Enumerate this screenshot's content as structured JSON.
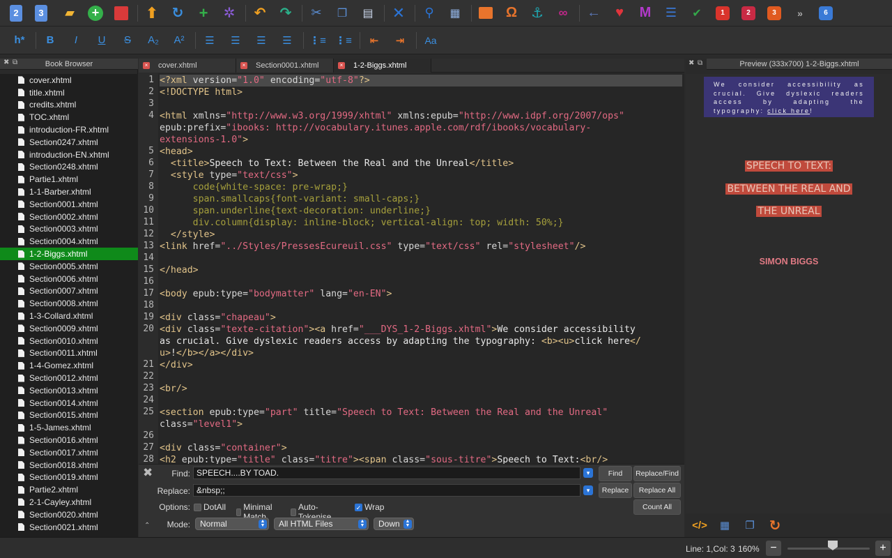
{
  "toolbar": {
    "icons": [
      "new-epub2-icon",
      "new-epub3-icon",
      "open-folder-icon",
      "add-file-icon",
      "save-icon",
      "move-up-icon",
      "reload-icon",
      "add-item-icon",
      "settings-gear-icon",
      "undo-icon",
      "redo-icon",
      "cut-icon",
      "copy-icon",
      "paste-icon",
      "validate-icon",
      "search-icon",
      "split-icon",
      "insert-image-icon",
      "special-character-icon",
      "anchor-icon",
      "link-icon",
      "back-arrow-icon",
      "favorite-heart-icon",
      "metadata-editor-icon",
      "toc-icon",
      "spellcheck-icon",
      "plugin-1-icon",
      "plugin-2-icon",
      "plugin-3-icon",
      "more-icon",
      "plugin-6-icon"
    ]
  },
  "format_toolbar": {
    "heading_label": "h*",
    "bold": "B",
    "italic": "I",
    "underline": "U",
    "strike": "S",
    "subscript": "A₂",
    "superscript": "A²",
    "case_label": "Aa"
  },
  "book_browser": {
    "title": "Book Browser",
    "files": [
      "cover.xhtml",
      "title.xhtml",
      "credits.xhtml",
      "TOC.xhtml",
      "introduction-FR.xhtml",
      "Section0247.xhtml",
      "introduction-EN.xhtml",
      "Section0248.xhtml",
      "Partie1.xhtml",
      "1-1-Barber.xhtml",
      "Section0001.xhtml",
      "Section0002.xhtml",
      "Section0003.xhtml",
      "Section0004.xhtml",
      "1-2-Biggs.xhtml",
      "Section0005.xhtml",
      "Section0006.xhtml",
      "Section0007.xhtml",
      "Section0008.xhtml",
      "1-3-Collard.xhtml",
      "Section0009.xhtml",
      "Section0010.xhtml",
      "Section0011.xhtml",
      "1-4-Gomez.xhtml",
      "Section0012.xhtml",
      "Section0013.xhtml",
      "Section0014.xhtml",
      "Section0015.xhtml",
      "1-5-James.xhtml",
      "Section0016.xhtml",
      "Section0017.xhtml",
      "Section0018.xhtml",
      "Section0019.xhtml",
      "Partie2.xhtml",
      "2-1-Cayley.xhtml",
      "Section0020.xhtml",
      "Section0021.xhtml"
    ],
    "selected": "1-2-Biggs.xhtml"
  },
  "tabs": [
    {
      "label": "cover.xhtml",
      "active": false
    },
    {
      "label": "Section0001.xhtml",
      "active": false
    },
    {
      "label": "1-2-Biggs.xhtml",
      "active": true
    }
  ],
  "editor": {
    "line_numbers": [
      "1",
      "2",
      "3",
      "4",
      "5",
      "6",
      "7",
      "8",
      "9",
      "10",
      "11",
      "12",
      "13",
      "14",
      "15",
      "16",
      "17",
      "18",
      "19",
      "20",
      "21",
      "22",
      "23",
      "24",
      "25",
      "26",
      "27",
      "28"
    ],
    "lines": [
      [
        [
          "tag",
          "<?xml "
        ],
        [
          "attr",
          "version="
        ],
        [
          "str",
          "\"1.0\""
        ],
        [
          "attr",
          " encoding="
        ],
        [
          "str",
          "\"utf-8\""
        ],
        [
          "tag",
          "?>"
        ]
      ],
      [
        [
          "tag",
          "<!DOCTYPE html>"
        ]
      ],
      [],
      [
        [
          "tag",
          "<html "
        ],
        [
          "attr",
          "xmlns="
        ],
        [
          "str",
          "\"http://www.w3.org/1999/xhtml\""
        ],
        [
          "attr",
          " xmlns:epub="
        ],
        [
          "str",
          "\"http://www.idpf.org/2007/ops\""
        ]
      ],
      [
        [
          "attr",
          "epub:prefix="
        ],
        [
          "str",
          "\"ibooks: http://vocabulary.itunes.apple.com/rdf/ibooks/vocabulary-"
        ]
      ],
      [
        [
          "str",
          "extensions-1.0\""
        ],
        [
          "tag",
          ">"
        ]
      ],
      [
        [
          "tag",
          "<head>"
        ]
      ],
      [
        [
          "txt",
          "  "
        ],
        [
          "tag",
          "<title>"
        ],
        [
          "txt",
          "Speech to Text: Between the Real and the Unreal"
        ],
        [
          "tag",
          "</title>"
        ]
      ],
      [
        [
          "txt",
          "  "
        ],
        [
          "tag",
          "<style "
        ],
        [
          "attr",
          "type="
        ],
        [
          "str",
          "\"text/css\""
        ],
        [
          "tag",
          ">"
        ]
      ],
      [
        [
          "css",
          "      code{white-space: pre-wrap;}"
        ]
      ],
      [
        [
          "css",
          "      span.smallcaps{font-variant: small-caps;}"
        ]
      ],
      [
        [
          "css",
          "      span.underline{text-decoration: underline;}"
        ]
      ],
      [
        [
          "css",
          "      div.column{display: inline-block; vertical-align: top; width: 50%;}"
        ]
      ],
      [
        [
          "txt",
          "  "
        ],
        [
          "tag",
          "</style>"
        ]
      ],
      [
        [
          "tag",
          "<link "
        ],
        [
          "attr",
          "href="
        ],
        [
          "str",
          "\"../Styles/PressesEcureuil.css\""
        ],
        [
          "attr",
          " type="
        ],
        [
          "str",
          "\"text/css\""
        ],
        [
          "attr",
          " rel="
        ],
        [
          "str",
          "\"stylesheet\""
        ],
        [
          "tag",
          "/>"
        ]
      ],
      [],
      [
        [
          "tag",
          "</head>"
        ]
      ],
      [],
      [
        [
          "tag",
          "<body "
        ],
        [
          "attr",
          "epub:type="
        ],
        [
          "str",
          "\"bodymatter\""
        ],
        [
          "attr",
          " lang="
        ],
        [
          "str",
          "\"en-EN\""
        ],
        [
          "tag",
          ">"
        ]
      ],
      [],
      [
        [
          "tag",
          "<div "
        ],
        [
          "attr",
          "class="
        ],
        [
          "str",
          "\"chapeau\""
        ],
        [
          "tag",
          ">"
        ]
      ],
      [
        [
          "tag",
          "<div "
        ],
        [
          "attr",
          "class="
        ],
        [
          "str",
          "\"texte-citation\""
        ],
        [
          "tag",
          "><a "
        ],
        [
          "attr",
          "href="
        ],
        [
          "str",
          "\"___DYS_1-2-Biggs.xhtml\""
        ],
        [
          "tag",
          ">"
        ],
        [
          "txt",
          "We consider accessibility"
        ]
      ],
      [
        [
          "txt",
          "as crucial. Give dyslexic readers access by adapting the typography: "
        ],
        [
          "tag",
          "<b><u>"
        ],
        [
          "txt",
          "click here"
        ],
        [
          "tag",
          "</"
        ]
      ],
      [
        [
          "tag",
          "u>"
        ],
        [
          "txt",
          "!"
        ],
        [
          "tag",
          "</b></a></div>"
        ]
      ],
      [
        [
          "tag",
          "</div>"
        ]
      ],
      [],
      [
        [
          "tag",
          "<br/>"
        ]
      ],
      [],
      [
        [
          "tag",
          "<section "
        ],
        [
          "attr",
          "epub:type="
        ],
        [
          "str",
          "\"part\""
        ],
        [
          "attr",
          " title="
        ],
        [
          "str",
          "\"Speech to Text: Between the Real and the Unreal\""
        ]
      ],
      [
        [
          "attr",
          "class="
        ],
        [
          "str",
          "\"level1\""
        ],
        [
          "tag",
          ">"
        ]
      ],
      [],
      [
        [
          "tag",
          "<div "
        ],
        [
          "attr",
          "class="
        ],
        [
          "str",
          "\"container\""
        ],
        [
          "tag",
          ">"
        ]
      ],
      [
        [
          "tag",
          "<h2 "
        ],
        [
          "attr",
          "epub:type="
        ],
        [
          "str",
          "\"title\""
        ],
        [
          "attr",
          " class="
        ],
        [
          "str",
          "\"titre\""
        ],
        [
          "tag",
          "><span "
        ],
        [
          "attr",
          "class="
        ],
        [
          "str",
          "\"sous-titre\""
        ],
        [
          "tag",
          ">"
        ],
        [
          "txt",
          "Speech to Text:"
        ],
        [
          "tag",
          "<br/>"
        ]
      ]
    ]
  },
  "find_replace": {
    "find_label": "Find:",
    "find_value": "SPEECH....BY TOAD.",
    "replace_label": "Replace:",
    "replace_value": "&nbsp;;",
    "options_label": "Options:",
    "mode_label": "Mode:",
    "options": [
      {
        "label": "DotAll",
        "checked": false
      },
      {
        "label": "Minimal Match",
        "checked": false
      },
      {
        "label": "Auto-Tokenise",
        "checked": false
      },
      {
        "label": "Wrap",
        "checked": true
      }
    ],
    "mode": "Normal",
    "scope": "All HTML Files",
    "direction": "Down",
    "buttons": {
      "find": "Find",
      "replace_find": "Replace/Find",
      "replace": "Replace",
      "replace_all": "Replace All",
      "count_all": "Count All"
    }
  },
  "preview": {
    "title": "Preview (333x700) 1-2-Biggs.xhtml",
    "box_text_before": "We consider accessibility as crucial. Give dyslexic readers access by adapting the typography: ",
    "box_link": "click here",
    "box_text_after": "!",
    "heading_lines": [
      "SPEECH TO TEXT:",
      "BETWEEN THE REAL AND",
      "THE UNREAL"
    ],
    "author": "SIMON BIGGS"
  },
  "status": {
    "position": "Line: 1,Col: 3",
    "zoom": "160%",
    "zoom_slider_level": 0.5
  },
  "colors": {
    "selected_row": "#0f8a1a",
    "accent_blue": "#2b74d6",
    "tag": "#e2c48a",
    "string": "#e36a83",
    "css": "#a6a03c"
  }
}
